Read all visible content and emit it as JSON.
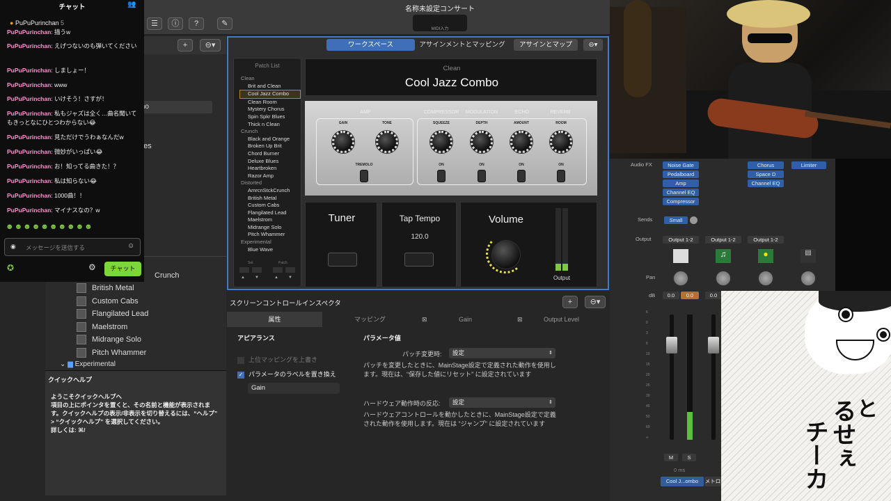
{
  "window": {
    "title": "名称未設定コンサート",
    "midi_label": "MIDI入力"
  },
  "browser": {
    "items": [
      "Crunch",
      "British Metal",
      "Custom Cabs",
      "Flangilated Lead",
      "Maelstrom",
      "Midrange Solo",
      "Pitch Whammer"
    ],
    "partial_items": [
      "mo",
      "ues",
      "e"
    ],
    "folder": "Experimental"
  },
  "help": {
    "title": "クイックヘルプ",
    "heading": "ようこそクイックヘルプへ",
    "body": "項目の上にポインタを置くと、その名前と機能が表示されます。クイックヘルプの表示/非表示を切り替えるには、“ヘルプ” > “クイックヘルプ” を選択してください。",
    "more": "詳しくは: ⌘/"
  },
  "workspace": {
    "tabs": {
      "workspace": "ワークスペース",
      "assign_mapping": "アサインメントとマッピング",
      "assign_map": "アサインとマップ"
    },
    "patch_list_title": "Patch List",
    "categories": [
      {
        "name": "Clean",
        "items": [
          "Brit and Clean",
          "Cool Jazz Combo",
          "Clean Room",
          "Mystery Chorus",
          "Spin Spkr Blues",
          "Thick n Clean"
        ]
      },
      {
        "name": "Crunch",
        "items": [
          "Black and Orange",
          "Broken Up Brit",
          "Chord Burner",
          "Deluxe Blues",
          "Heartbroken",
          "Razor Amp"
        ]
      },
      {
        "name": "Distorted",
        "items": [
          "AmrcnStckCrunch",
          "British Metal",
          "Custom Cabs",
          "Flangilated Lead",
          "Maelstrom",
          "Midrange Solo",
          "Pitch Whammer"
        ]
      },
      {
        "name": "Experimental",
        "items": [
          "Blue Wave"
        ]
      }
    ],
    "selected": "Cool Jazz Combo",
    "set_label": "Set",
    "patch_label": "Patch",
    "patch_category": "Clean",
    "patch_name": "Cool Jazz Combo",
    "amp": {
      "sections": [
        "AMP",
        "COMPRESSOR",
        "MODULATION",
        "ECHO",
        "REVERB"
      ],
      "knobs": [
        "GAIN",
        "TONE",
        "SQUEEZE",
        "DEPTH",
        "AMOUNT",
        "ROOM"
      ],
      "switches": [
        "TREMOLO",
        "ON",
        "ON",
        "ON",
        "ON"
      ]
    },
    "tuner": "Tuner",
    "tap_tempo": "Tap Tempo",
    "tempo_value": "120.0",
    "volume": "Volume",
    "output": "Output"
  },
  "inspector": {
    "title": "スクリーンコントロールインスペクタ",
    "tabs": [
      "属性",
      "マッピング",
      "Gain",
      "Output Level"
    ],
    "appearance": "アピアランス",
    "override": "上位マッピングを上書き",
    "replace_label": "パラメータのラベルを置き換え",
    "label_value": "Gain",
    "param_value": "パラメータ値",
    "patch_change": "パッチ変更時:",
    "patch_change_value": "設定",
    "patch_desc": "パッチを変更したときに、MainStage設定で定義された動作を使用します。現在は、“保存した値にリセット” に設定されています",
    "hw_label": "ハードウェア動作時の反応:",
    "hw_value": "設定",
    "hw_desc": "ハードウェアコントロールを動かしたときに、MainStage設定で定義された動作を使用します。現在は “ジャンプ” に設定されています"
  },
  "chat": {
    "title": "チャット",
    "badge_user": "PuPuPurinchan",
    "badge_count": "5",
    "messages": [
      {
        "user": "PuPuPurinchan",
        "text": "描うw"
      },
      {
        "user": "PuPuPurinchan",
        "text": "えげつないのも弾いてください"
      },
      {
        "user": "PuPuPurinchan",
        "text": "しましょー！"
      },
      {
        "user": "PuPuPurinchan",
        "text": "www"
      },
      {
        "user": "PuPuPurinchan",
        "text": "いけそう！さすが！"
      },
      {
        "user": "PuPuPurinchan",
        "text": "私もジャズは全く…曲名聞いてもきっとなにひとつわからない😂"
      },
      {
        "user": "PuPuPurinchan",
        "text": "見ただけでうわぁなんだw"
      },
      {
        "user": "PuPuPurinchan",
        "text": "微妙がいっぱい😂"
      },
      {
        "user": "PuPuPurinchan",
        "text": "お！知ってる曲きた！？"
      },
      {
        "user": "PuPuPurinchan",
        "text": "私は知らない😂"
      },
      {
        "user": "PuPuPurinchan",
        "text": "1000曲！！"
      },
      {
        "user": "PuPuPurinchan",
        "text": "マイナスなの？w"
      }
    ],
    "placeholder": "メッセージを送信する",
    "send": "チャット"
  },
  "mixer": {
    "audio_fx": "Audio FX",
    "sends": "Sends",
    "output": "Output",
    "pan": "Pan",
    "db": "dB",
    "ch1_fx": [
      "Noise Gate",
      "Pedalboard",
      "Amp",
      "Channel EQ",
      "Compressor"
    ],
    "ch3_fx": [
      "Chorus",
      "Space D",
      "Channel EQ"
    ],
    "ch4_fx": [
      "Limiter"
    ],
    "send_value": "Small",
    "outputs": [
      "Output 1-2",
      "Output 1-2",
      "Output 1-2"
    ],
    "db_values": [
      "0.0",
      "0.0",
      "0.0"
    ],
    "scale": [
      "6",
      "0",
      "3",
      "6",
      "10",
      "15",
      "20",
      "25",
      "30",
      "40",
      "50",
      "60",
      "∞"
    ],
    "mute": "M",
    "solo": "S",
    "latency": "0 ms",
    "ch_names": [
      "Cool J...ombo",
      "メトロ"
    ]
  },
  "manga": {
    "text1": "るせぇ",
    "text2": "チーカ",
    "text3": "と"
  }
}
